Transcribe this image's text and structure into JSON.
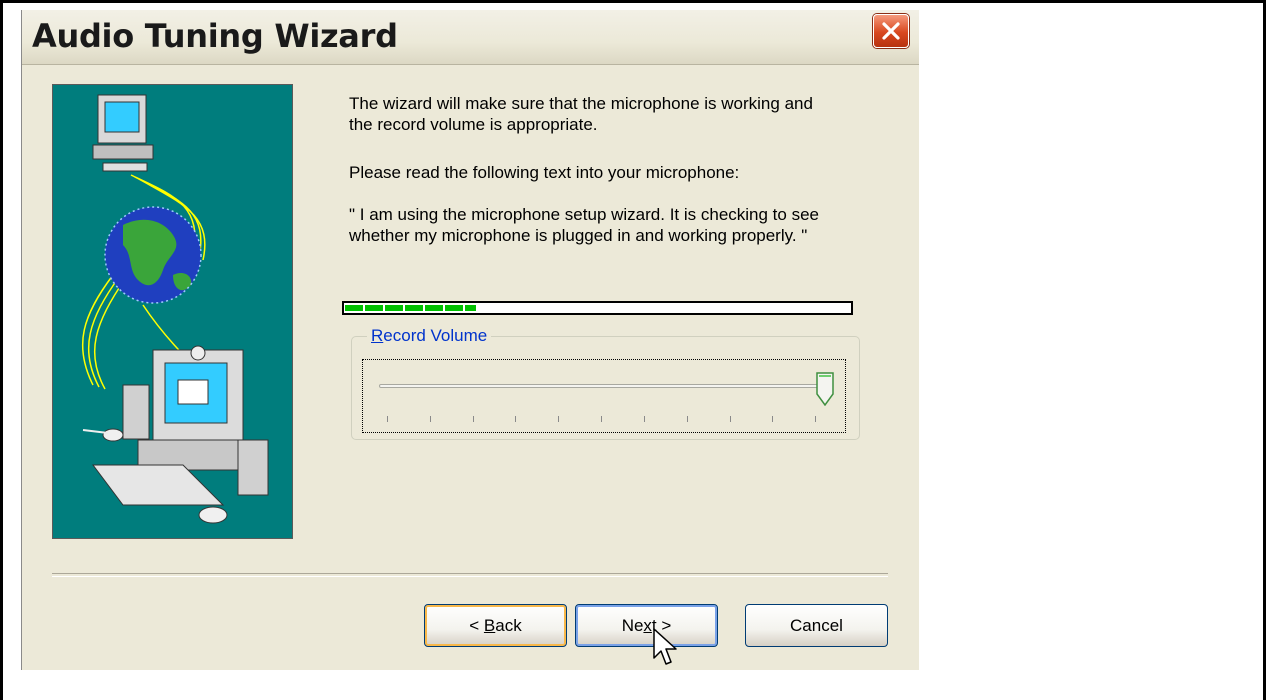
{
  "window": {
    "title": "Audio Tuning Wizard",
    "close_icon": "close-icon"
  },
  "content": {
    "intro": "The wizard will make sure that the microphone is working and the record volume is appropriate.",
    "instruction": "Please read the following text into your microphone:",
    "quote": "\" I am using the microphone setup wizard. It is checking to see whether my microphone is plugged in and working properly. \""
  },
  "level_meter": {
    "level_fraction": 0.26,
    "fill_color": "#00c000"
  },
  "record_volume": {
    "label_accel": "R",
    "label_rest": "ecord Volume",
    "value_fraction": 1.0
  },
  "buttons": {
    "back_accel": "B",
    "back_rest": "ack",
    "back_prefix": "< ",
    "next_prefix": "Ne",
    "next_accel": "x",
    "next_rest": "t >",
    "cancel": "Cancel"
  },
  "colors": {
    "dialog_bg": "#ece9d8",
    "art_bg": "#007d7d",
    "close_red": "#d8471f",
    "label_blue": "#0033cc"
  }
}
